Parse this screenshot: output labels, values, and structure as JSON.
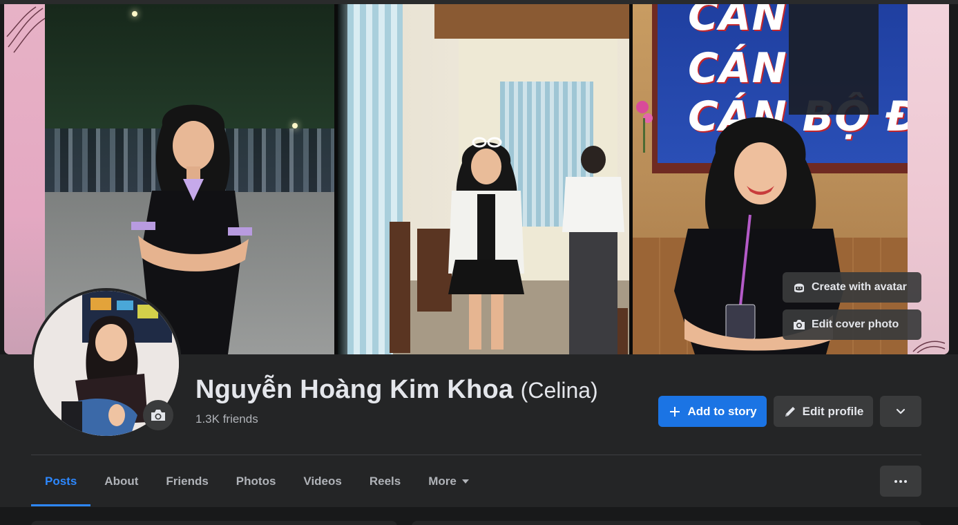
{
  "cover": {
    "actions": {
      "create_avatar_label": "Create with avatar",
      "edit_cover_label": "Edit cover photo"
    },
    "banner_lines": [
      "CÁN",
      "CÁN",
      "CÁN BỘ ĐO"
    ]
  },
  "profile": {
    "name": "Nguyễn Hoàng Kim Khoa",
    "alternate_name": "(Celina)",
    "friends_count": "1.3K friends"
  },
  "actions": {
    "add_story_label": "Add to story",
    "edit_profile_label": "Edit profile"
  },
  "tabs": [
    {
      "label": "Posts",
      "active": true
    },
    {
      "label": "About",
      "active": false
    },
    {
      "label": "Friends",
      "active": false
    },
    {
      "label": "Photos",
      "active": false
    },
    {
      "label": "Videos",
      "active": false
    },
    {
      "label": "Reels",
      "active": false
    },
    {
      "label": "More",
      "active": false
    }
  ],
  "colors": {
    "accent": "#1b74e4",
    "active_tab": "#2d88ff",
    "surface": "#242526",
    "background": "#18191a",
    "button": "#3a3b3c"
  },
  "icons": {
    "create_avatar": "avatar-sticker-icon",
    "edit_cover": "camera-icon",
    "avatar_camera": "camera-icon",
    "add_story": "plus-icon",
    "edit_profile": "pencil-icon",
    "dropdown": "chevron-down-icon",
    "tab_menu": "ellipsis-icon"
  }
}
